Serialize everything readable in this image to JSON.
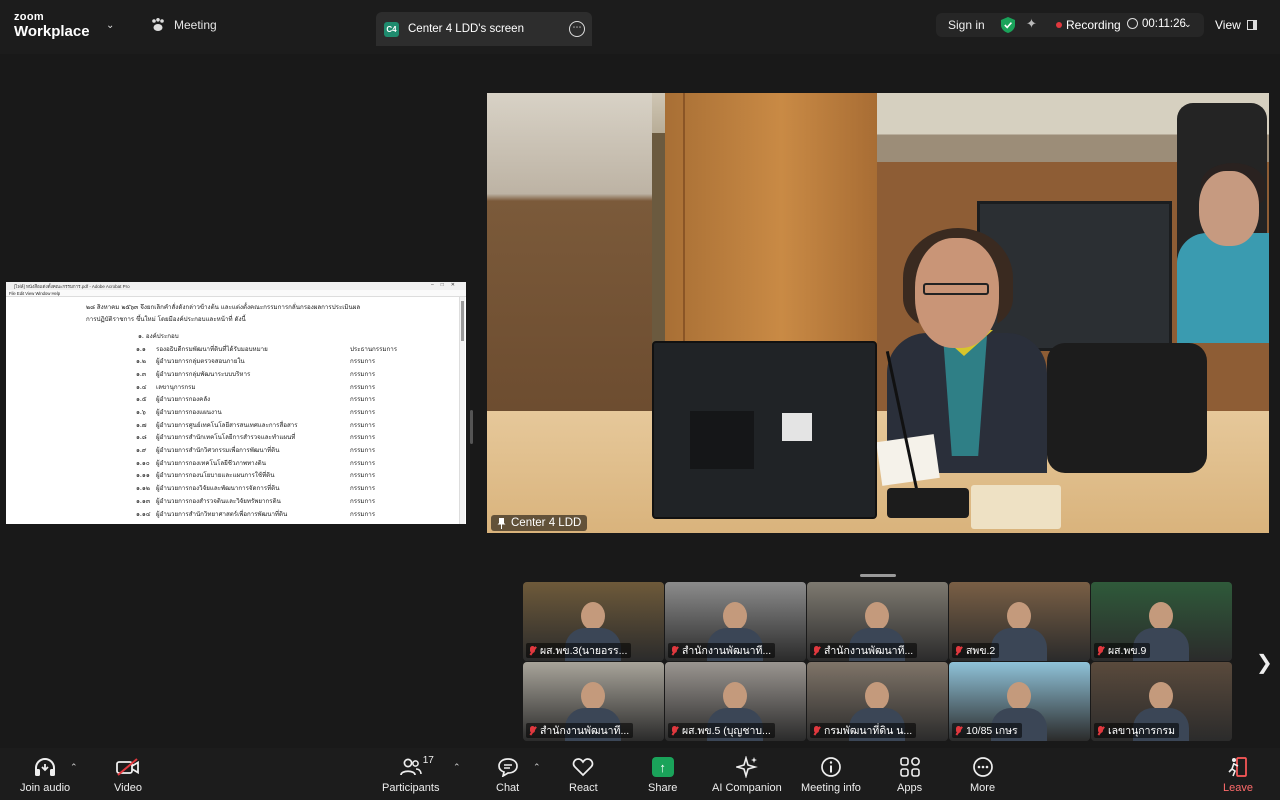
{
  "app": {
    "brand_top": "zoom",
    "brand_bottom": "Workplace",
    "meeting_label": "Meeting"
  },
  "screen_tab": {
    "avatar": "C4",
    "title": "Center 4 LDD's screen"
  },
  "status": {
    "signin": "Sign in",
    "recording": "Recording",
    "timer": "00:11:26",
    "view": "View",
    "recording_color": "#e0383e",
    "shield_color": "#1aa35a"
  },
  "document": {
    "titlebar": "[ไฟล์] หนังสือแต่งตั้งคณะกรรมการ.pdf - Adobe Acrobat Pro",
    "menu": "File  Edit  View  Window  Help",
    "intro_line1": "๒๘ สิงหาคม ๒๕๖๓ จึงยกเลิกคำสั่งดังกล่าวข้างต้น และแต่งตั้งคณะกรรมการกลั่นกรองผลการประเมินผล",
    "intro_line2": "การปฏิบัติราชการ ขึ้นใหม่ โดยมีองค์ประกอบและหน้าที่ ดังนี้",
    "section": "๑. องค์ประกอบ",
    "rows": [
      {
        "num": "๑.๑",
        "name": "รองอธิบดีกรมพัฒนาที่ดินที่ได้รับมอบหมาย",
        "role": "ประธานกรรมการ"
      },
      {
        "num": "๑.๒",
        "name": "ผู้อำนวยการกลุ่มตรวจสอบภายใน",
        "role": "กรรมการ"
      },
      {
        "num": "๑.๓",
        "name": "ผู้อำนวยการกลุ่มพัฒนาระบบบริหาร",
        "role": "กรรมการ"
      },
      {
        "num": "๑.๔",
        "name": "เลขานุการกรม",
        "role": "กรรมการ"
      },
      {
        "num": "๑.๕",
        "name": "ผู้อำนวยการกองคลัง",
        "role": "กรรมการ"
      },
      {
        "num": "๑.๖",
        "name": "ผู้อำนวยการกองแผนงาน",
        "role": "กรรมการ"
      },
      {
        "num": "๑.๗",
        "name": "ผู้อำนวยการศูนย์เทคโนโลยีสารสนเทศและการสื่อสาร",
        "role": "กรรมการ"
      },
      {
        "num": "๑.๘",
        "name": "ผู้อำนวยการสำนักเทคโนโลยีการสำรวจและทำแผนที่",
        "role": "กรรมการ"
      },
      {
        "num": "๑.๙",
        "name": "ผู้อำนวยการสำนักวิศวกรรมเพื่อการพัฒนาที่ดิน",
        "role": "กรรมการ"
      },
      {
        "num": "๑.๑๐",
        "name": "ผู้อำนวยการกองเทคโนโลยีชีวภาพทางดิน",
        "role": "กรรมการ"
      },
      {
        "num": "๑.๑๑",
        "name": "ผู้อำนวยการกองนโยบายและแผนการใช้ที่ดิน",
        "role": "กรรมการ"
      },
      {
        "num": "๑.๑๒",
        "name": "ผู้อำนวยการกองวิจัยและพัฒนาการจัดการที่ดิน",
        "role": "กรรมการ"
      },
      {
        "num": "๑.๑๓",
        "name": "ผู้อำนวยการกองสำรวจดินและวิจัยทรัพยากรดิน",
        "role": "กรรมการ"
      },
      {
        "num": "๑.๑๔",
        "name": "ผู้อำนวยการสำนักวิทยาศาสตร์เพื่อการพัฒนาที่ดิน",
        "role": "กรรมการ"
      }
    ]
  },
  "speaker": {
    "name": "Center 4 LDD"
  },
  "gallery": {
    "tiles": [
      {
        "name": "ผส.พข.3(นายอรร...",
        "bg": "#6e5a3a"
      },
      {
        "name": "สำนักงานพัฒนาที...",
        "bg": "#8c8c8c"
      },
      {
        "name": "สำนักงานพัฒนาที...",
        "bg": "#7e7a70"
      },
      {
        "name": "สพข.2",
        "bg": "#7a5f45"
      },
      {
        "name": "ผส.พข.9",
        "bg": "#2f5a3a"
      },
      {
        "name": "สำนักงานพัฒนาที...",
        "bg": "#a8a49a"
      },
      {
        "name": "ผส.พข.5 (บุญชาบ...",
        "bg": "#9a9590"
      },
      {
        "name": "กรมพัฒนาที่ดิน น...",
        "bg": "#7f7468"
      },
      {
        "name": "10/85 เกษร",
        "bg": "#8fc2d8"
      },
      {
        "name": "เลขานุการกรม",
        "bg": "#5a4a3c"
      }
    ]
  },
  "toolbar": {
    "join_audio": "Join audio",
    "video": "Video",
    "participants": "Participants",
    "participants_count": "17",
    "chat": "Chat",
    "react": "React",
    "share": "Share",
    "ai_companion": "AI Companion",
    "meeting_info": "Meeting info",
    "apps": "Apps",
    "more": "More",
    "leave": "Leave"
  }
}
